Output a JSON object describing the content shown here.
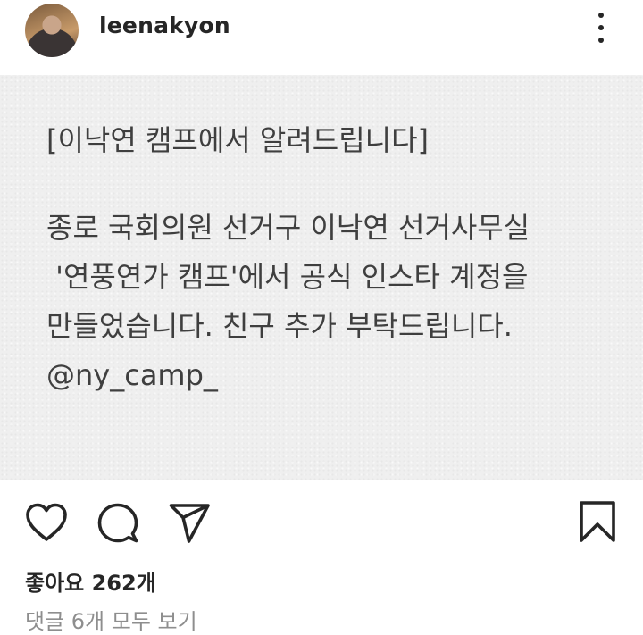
{
  "header": {
    "username": "leenakyon",
    "avatar_icon": "profile-photo",
    "more_icon": "more-vertical-icon"
  },
  "post": {
    "lines": [
      "[이낙연 캠프에서 알려드립니다]",
      "종로 국회의원 선거구 이낙연 선거사무실",
      " '연풍연가 캠프'에서 공식 인스타 계정을",
      "만들었습니다. 친구 추가 부탁드립니다.",
      "@ny_camp_"
    ]
  },
  "actions": {
    "icons": [
      "heart-icon",
      "comment-icon",
      "share-icon",
      "bookmark-icon"
    ],
    "likes_text": "좋아요 262개",
    "comments_text": "댓글 6개 모두 보기"
  }
}
